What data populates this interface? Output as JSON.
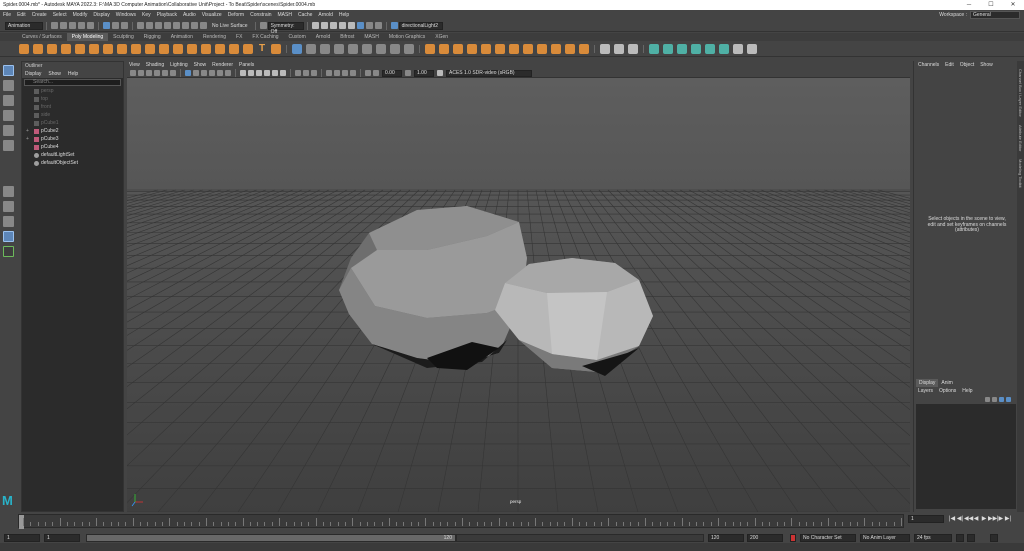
{
  "window": {
    "title": "Spider.0004.mb* - Autodesk MAYA 2022.3: F:\\MA 3D Computer Animation\\Collaborative Unit\\Project - To Beat\\Spider\\scenes\\Spider.0004.mb",
    "minimize": "─",
    "maximize": "☐",
    "close": "✕"
  },
  "menubar": {
    "items": [
      "File",
      "Edit",
      "Create",
      "Select",
      "Modify",
      "Display",
      "Windows",
      "Key",
      "Playback",
      "Audio",
      "Visualize",
      "Deform",
      "Constrain",
      "MASH",
      "Cache",
      "Arnold",
      "Help"
    ],
    "workspace_label": "Workspace :",
    "workspace_value": "General"
  },
  "statusline": {
    "menuset": "Animation",
    "live_surface": "No Live Surface",
    "symmetry": "Symmetry: Off",
    "camera": "directionalLight2"
  },
  "shelf": {
    "tabs": [
      "Curves / Surfaces",
      "Poly Modeling",
      "Sculpting",
      "Rigging",
      "Animation",
      "Rendering",
      "FX",
      "FX Caching",
      "Custom",
      "Arnold",
      "Bifrost",
      "MASH",
      "Motion Graphics",
      "XGen"
    ],
    "active_tab": "Poly Modeling",
    "text_tool": "T"
  },
  "outliner": {
    "title": "Outliner",
    "menu": [
      "Display",
      "Show",
      "Help"
    ],
    "search_placeholder": "Search...",
    "items": [
      {
        "label": "persp",
        "type": "dim",
        "expand": ""
      },
      {
        "label": "top",
        "type": "dim",
        "expand": ""
      },
      {
        "label": "front",
        "type": "dim",
        "expand": ""
      },
      {
        "label": "side",
        "type": "dim",
        "expand": ""
      },
      {
        "label": "pCube1",
        "type": "dim",
        "expand": ""
      },
      {
        "label": "pCube2",
        "type": "mesh",
        "expand": "+"
      },
      {
        "label": "pCube3",
        "type": "mesh",
        "expand": "+"
      },
      {
        "label": "pCube4",
        "type": "mesh",
        "expand": ""
      },
      {
        "label": "defaultLightSet",
        "type": "set",
        "expand": ""
      },
      {
        "label": "defaultObjectSet",
        "type": "set",
        "expand": ""
      }
    ]
  },
  "viewport": {
    "menu": [
      "View",
      "Shading",
      "Lighting",
      "Show",
      "Renderer",
      "Panels"
    ],
    "near_value": "0.00",
    "far_value": "1.00",
    "colorspace": "ACES 1.0 SDR-video (sRGB)",
    "camera_label": "persp"
  },
  "channelbox": {
    "menu": [
      "Channels",
      "Edit",
      "Object",
      "Show"
    ],
    "hint": "Select objects in the scene to view, edit and set keyframes on channels (attributes)",
    "layer_tabs": [
      "Display",
      "Anim"
    ],
    "layer_menu": [
      "Layers",
      "Options",
      "Help"
    ]
  },
  "sidetabs": [
    "Channel Box / Layer Editor",
    "Attribute Editor",
    "Modeling Toolkit"
  ],
  "timeslider": {
    "current_frame": "1",
    "playback_icons": [
      "|◀",
      "◀|",
      "◀◀",
      "◀",
      "▶",
      "▶▶",
      "|▶",
      "▶|"
    ]
  },
  "rangeslider": {
    "start": "1",
    "inner_start": "1",
    "range_end_label": "120",
    "end": "120",
    "outer_end": "200",
    "character_set": "No Character Set",
    "anim_layer": "No Anim Layer",
    "fps": "24 fps"
  },
  "logo": {
    "letter": "M"
  }
}
